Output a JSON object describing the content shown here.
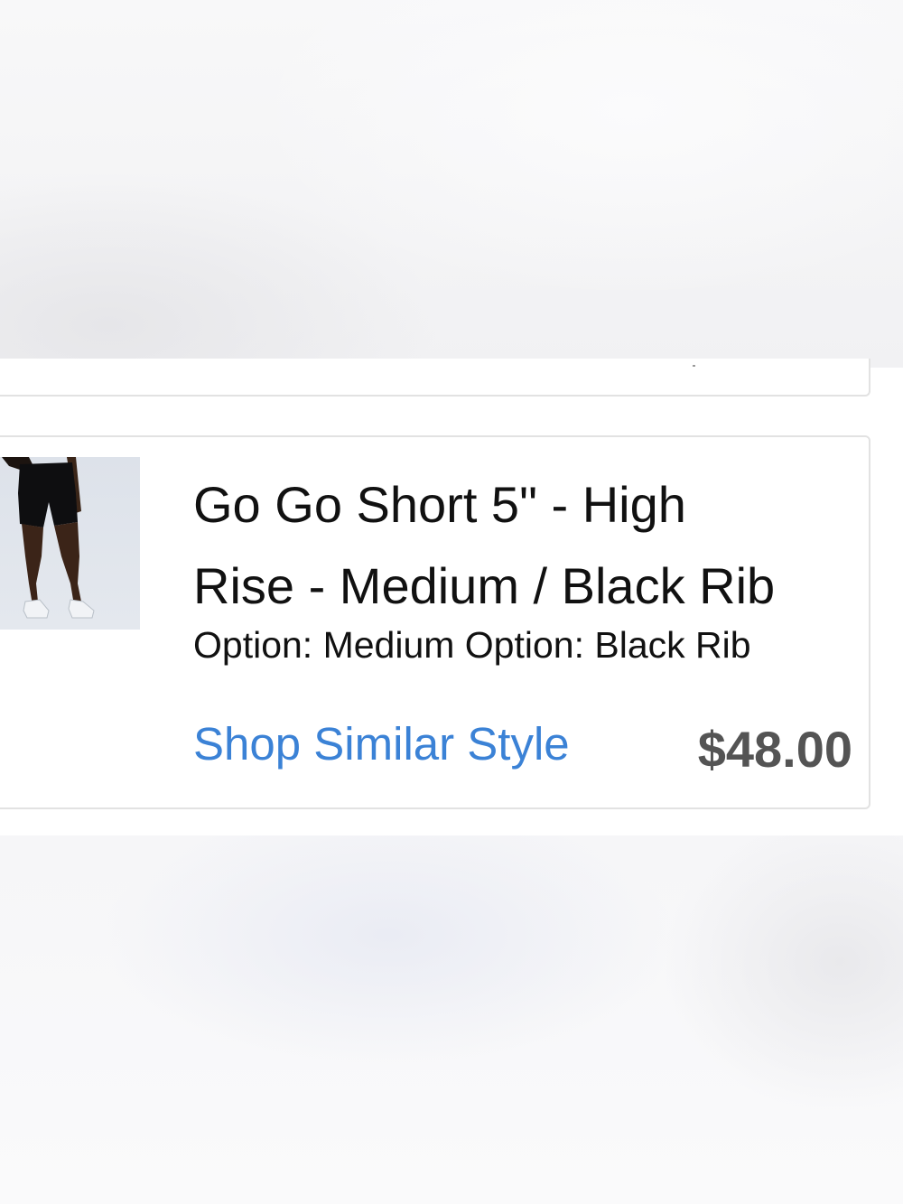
{
  "order_item": {
    "title_line1": "Go Go Short 5\" - High",
    "title_line2": "Rise - Medium / Black Rib",
    "options": "Option: Medium Option: Black Rib",
    "shop_link_label": "Shop Similar Style",
    "price": "$48.00",
    "image_alt": "Go Go Short product photo",
    "colors": {
      "link": "#3b82d6",
      "price": "#545454",
      "card_border": "#e2e2e2"
    }
  }
}
